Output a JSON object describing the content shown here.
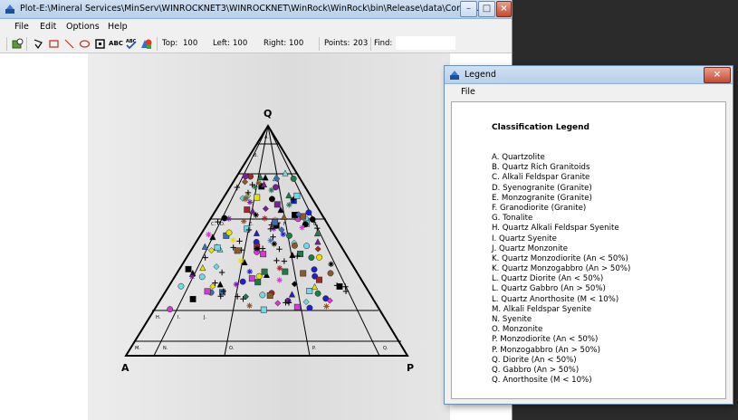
{
  "main_window": {
    "title": "Plot-E:\\Mineral Services\\MinServ\\WINROCKNET3\\WINROCKNET\\WinRock\\WinRock\\bin\\Release\\data\\Comrie.rok",
    "menu": [
      "File",
      "Edit",
      "Options",
      "Help"
    ],
    "toolbar": {
      "top_label": "Top:",
      "top_value": "100",
      "left_label": "Left:",
      "left_value": "100",
      "right_label": "Right:",
      "right_value": "100",
      "points_label": "Points:",
      "points_value": "203",
      "find_label": "Find:",
      "find_value": "",
      "abc_label": "ABC",
      "abc_check_label": "ABC"
    },
    "icons": [
      "zoom-icon",
      "polygon-icon",
      "rectangle-icon",
      "line-icon",
      "ellipse-icon",
      "frame-icon",
      "text-icon",
      "spellcheck-icon",
      "shapes-icon"
    ]
  },
  "plot": {
    "apex_top": "Q",
    "apex_left": "A",
    "apex_right": "P",
    "field_labels": [
      "A.",
      "B.",
      "C.",
      "D.",
      "E.",
      "F.",
      "G.",
      "H.",
      "I.",
      "J.",
      "M.",
      "N.",
      "O.",
      "P.",
      "Q."
    ]
  },
  "legend_window": {
    "title": "Legend",
    "menu": [
      "File"
    ],
    "heading": "Classification Legend",
    "items": [
      "A.  Quartzolite",
      "B.  Quartz Rich Granitoids",
      "C.  Alkali Feldspar Granite",
      "D.  Syenogranite (Granite)",
      "E.  Monzogranite (Granite)",
      "F.  Granodiorite (Granite)",
      "G.  Tonalite",
      "H.  Quartz Alkali Feldspar Syenite",
      "I.  Quartz Syenite",
      "J.  Quartz Monzonite",
      "K.  Quartz Monzodiorite (An < 50%)",
      "K.  Quartz Monzogabbro (An > 50%)",
      "L.  Quartz Diorite (An < 50%)",
      "L.  Quartz Gabbro (An > 50%)",
      "L.  Quartz Anorthosite (M < 10%)",
      "M.  Alkali Feldspar Syenite",
      "N.  Syenite",
      "O.  Monzonite",
      "P.  Monzodiorite (An < 50%)",
      "P.  Monzogabbro (An > 50%)",
      "Q.  Diorite (An < 50%)",
      "Q.  Gabbro (An > 50%)",
      "Q.  Anorthosite (M < 10%)"
    ]
  }
}
